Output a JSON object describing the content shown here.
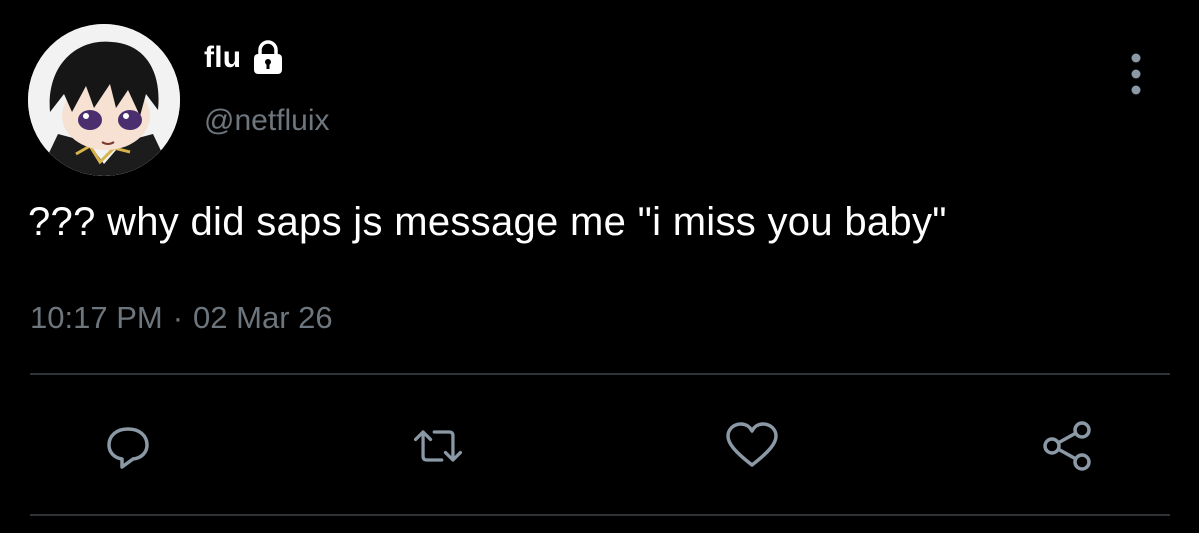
{
  "author": {
    "display_name": "flu",
    "handle": "@netfluix",
    "protected": true
  },
  "tweet": {
    "text": "??? why did saps js message me \"i miss you baby\"",
    "time": "10:17 PM",
    "separator": "·",
    "date": "02 Mar 26"
  },
  "icons": {
    "avatar": "anime-avatar",
    "lock": "lock-icon",
    "more": "more-vertical-icon",
    "reply": "reply-icon",
    "retweet": "retweet-icon",
    "like": "heart-icon",
    "share": "share-icon"
  },
  "colors": {
    "background": "#000000",
    "primary_text": "#ffffff",
    "secondary_text": "#6e767d",
    "divider": "#2f3336",
    "icon": "#8b98a5"
  }
}
